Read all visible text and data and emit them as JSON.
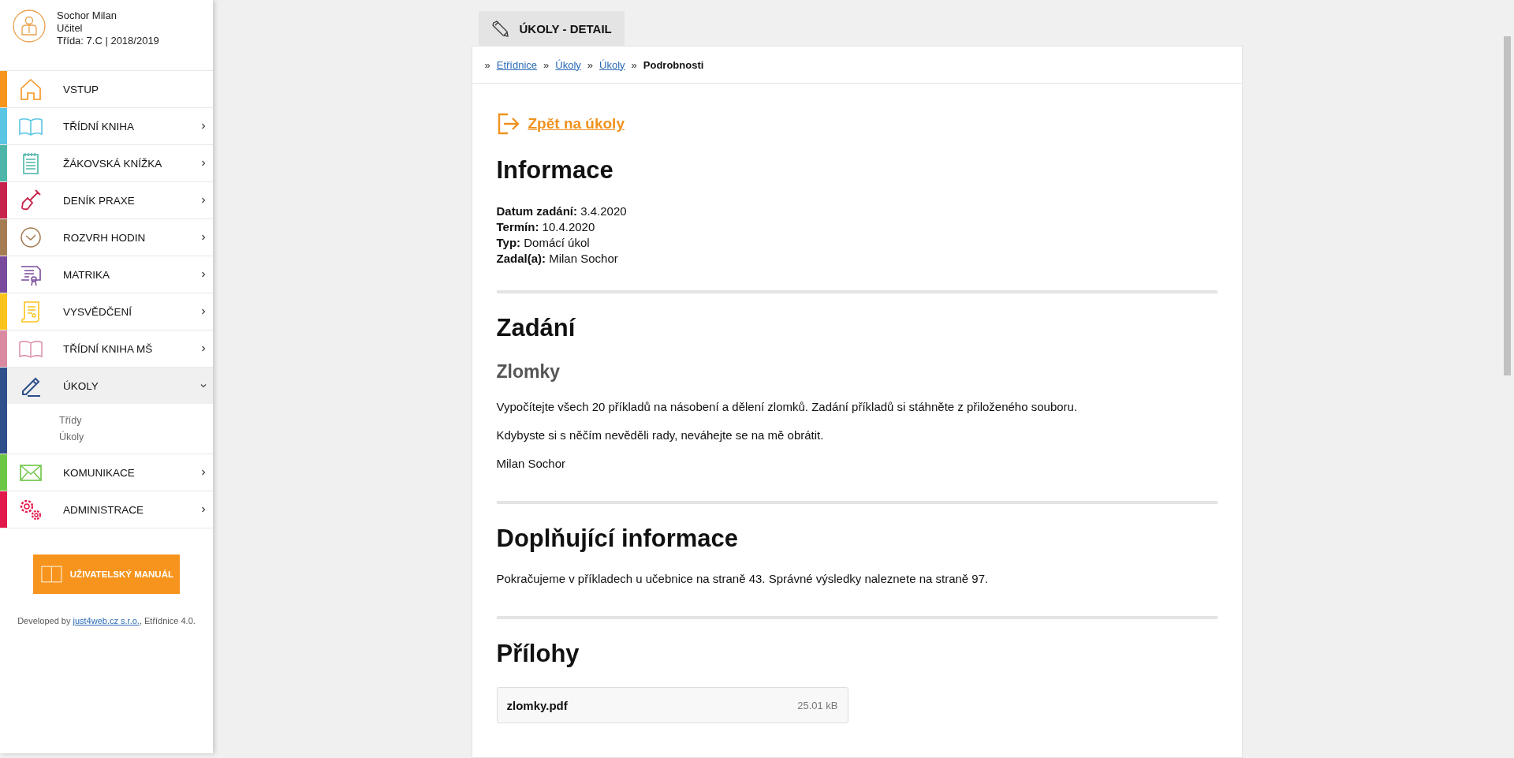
{
  "user": {
    "name": "Sochor Milan",
    "role": "Učitel",
    "class_info": "Třída: 7.C | 2018/2019"
  },
  "menu": [
    {
      "label": "VSTUP",
      "kind": "link",
      "color": "#f7941d",
      "selected": false
    },
    {
      "label": "TŘÍDNÍ KNIHA",
      "kind": "group",
      "color": "#5bc5e4",
      "selected": false,
      "expanded": false
    },
    {
      "label": "ŽÁKOVSKÁ KNÍŽKA",
      "kind": "group",
      "color": "#4db6a8",
      "selected": false,
      "expanded": false
    },
    {
      "label": "DENÍK PRAXE",
      "kind": "group",
      "color": "#c8234b",
      "selected": false,
      "expanded": false
    },
    {
      "label": "ROZVRH HODIN",
      "kind": "group",
      "color": "#a57c52",
      "selected": false,
      "expanded": false
    },
    {
      "label": "MATRIKA",
      "kind": "group",
      "color": "#7a4b9c",
      "selected": false,
      "expanded": false
    },
    {
      "label": "VYSVĚDČENÍ",
      "kind": "group",
      "color": "#fcc31d",
      "selected": false,
      "expanded": false
    },
    {
      "label": "TŘÍDNÍ KNIHA MŠ",
      "kind": "group",
      "color": "#d98aa0",
      "selected": false,
      "expanded": false
    },
    {
      "label": "ÚKOLY",
      "kind": "group",
      "color": "#2e4f8a",
      "selected": true,
      "expanded": true,
      "children": [
        {
          "label": "Třídy"
        },
        {
          "label": "Úkoly"
        }
      ]
    },
    {
      "label": "KOMUNIKACE",
      "kind": "group",
      "color": "#6cc644",
      "selected": false,
      "expanded": false
    },
    {
      "label": "ADMINISTRACE",
      "kind": "group",
      "color": "#e3194b",
      "selected": false,
      "expanded": false
    }
  ],
  "manual_button": "UŽIVATELSKÝ MANUÁL",
  "footer": {
    "prefix": "Developed by ",
    "link": "just4web.cz s.r.o.",
    "suffix": ", Etřídnice 4.0."
  },
  "page_tab": "ÚKOLY - DETAIL",
  "breadcrumb": {
    "separator": "»",
    "items": [
      {
        "label": "Etřídnice",
        "current": false
      },
      {
        "label": "Úkoly",
        "current": false
      },
      {
        "label": "Úkoly",
        "current": false
      },
      {
        "label": "Podrobnosti",
        "current": true
      }
    ]
  },
  "back_link": "Zpět na úkoly",
  "sections": [
    {
      "kind": "info",
      "title": "Informace",
      "lines": [
        "**Datum zadání:** 3.4.2020",
        "**Termín:** 10.4.2020",
        "**Typ:** Domácí úkol",
        "**Zadal(a):** Milan Sochor"
      ]
    },
    {
      "kind": "text",
      "title": "Zadání",
      "subtitle": "Zlomky",
      "paragraphs": [
        "Vypočítejte všech 20 příkladů na násobení a dělení zlomků. Zadání příkladů si stáhněte z přiloženého souboru.",
        "Kdybyste si s něčím nevěděli rady, neváhejte se na mě obrátit.",
        "Milan Sochor"
      ]
    },
    {
      "kind": "text",
      "title": "Doplňující informace",
      "paragraphs": [
        "Pokračujeme v příkladech u učebnice na straně 43. Správné výsledky naleznete na straně 97."
      ]
    },
    {
      "kind": "files",
      "title": "Přílohy",
      "files": [
        {
          "name": "zlomky.pdf",
          "size": "25.01 kB"
        }
      ]
    }
  ]
}
